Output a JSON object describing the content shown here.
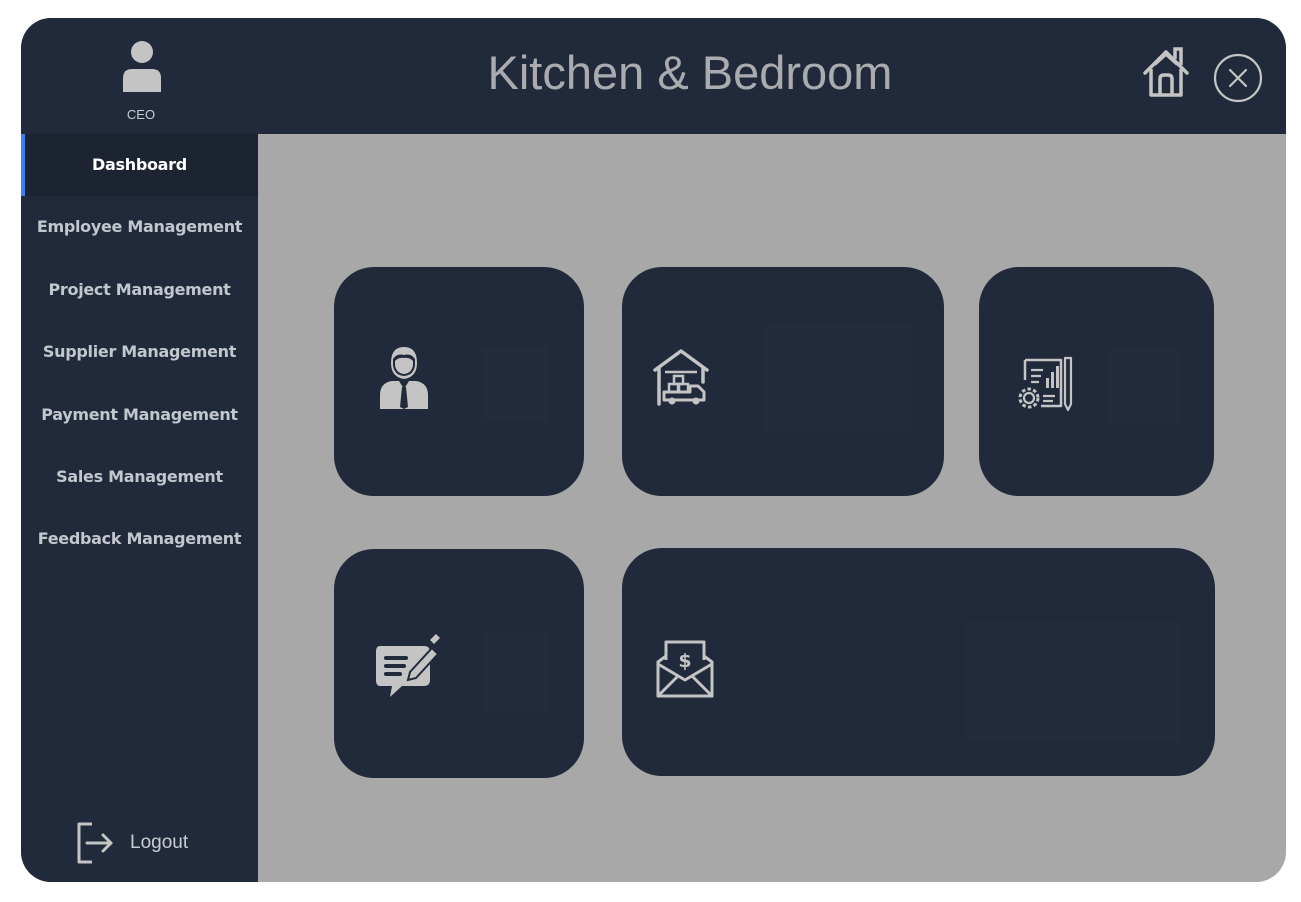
{
  "header": {
    "title": "Kitchen & Bedroom",
    "role": "CEO",
    "icons": {
      "profile": "user-icon",
      "home": "home-icon",
      "close": "close-circle-icon"
    }
  },
  "sidebar": {
    "items": [
      {
        "label": "Dashboard",
        "active": true
      },
      {
        "label": "Employee Management",
        "active": false
      },
      {
        "label": "Project Management",
        "active": false
      },
      {
        "label": "Supplier Management",
        "active": false
      },
      {
        "label": "Payment Management",
        "active": false
      },
      {
        "label": "Sales Management",
        "active": false
      },
      {
        "label": "Feedback Management",
        "active": false
      }
    ],
    "logout_label": "Logout",
    "logout_icon": "logout-icon"
  },
  "cards": [
    {
      "icon": "employee-icon"
    },
    {
      "icon": "warehouse-delivery-icon"
    },
    {
      "icon": "project-plan-icon"
    },
    {
      "icon": "feedback-icon"
    },
    {
      "icon": "payment-envelope-icon"
    }
  ],
  "colors": {
    "panel": "#212a3a",
    "content_bg": "#a8a8a8",
    "accent": "#3d7ef2",
    "icon": "#c4c4c4",
    "title": "#a9abae"
  }
}
